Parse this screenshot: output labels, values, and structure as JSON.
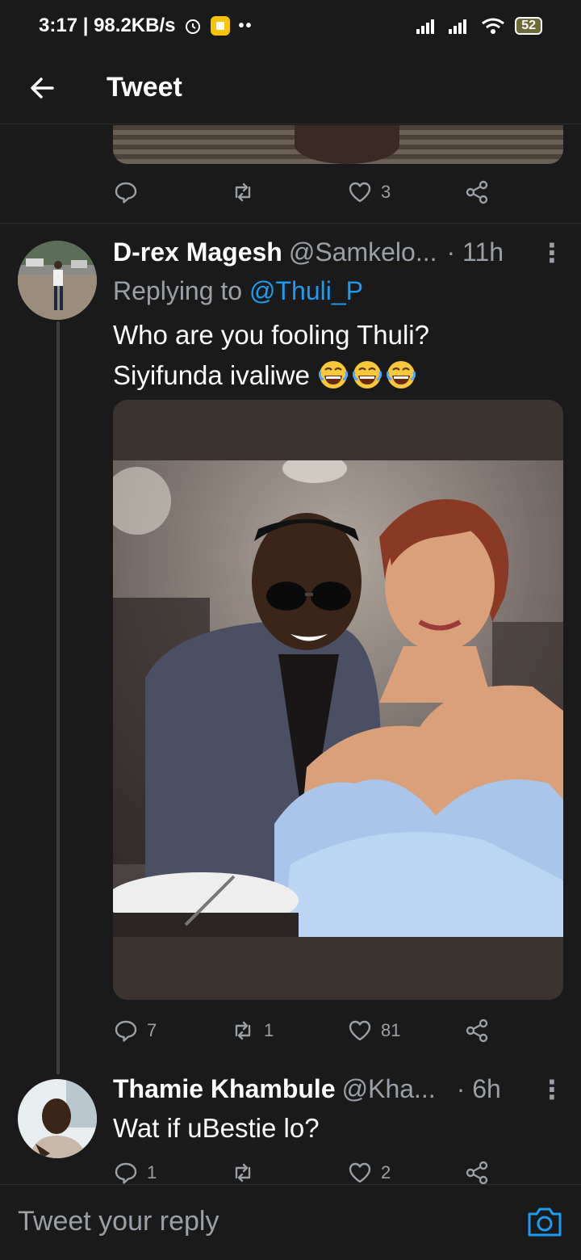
{
  "status_bar": {
    "time_speed": "3:17 | 98.2KB/s",
    "battery": "52"
  },
  "header": {
    "title": "Tweet"
  },
  "prev_tweet": {
    "likes": "3"
  },
  "tweets": [
    {
      "name": "D-rex Magesh",
      "handle": "@Samkelo...",
      "time": "· 11h",
      "replying_label": "Replying to ",
      "replying_to": "@Thuli_P",
      "text_line1": "Who are you fooling Thuli?",
      "text_line2": "Siyifunda ivaliwe ",
      "replies": "7",
      "retweets": "1",
      "likes": "81"
    },
    {
      "name": "Thamie Khambule",
      "handle": "@Kha...",
      "time": "· 6h",
      "text": "Wat if uBestie lo?",
      "replies": "1",
      "likes": "2"
    }
  ],
  "reply_bar": {
    "placeholder": "Tweet your reply"
  },
  "icons": [
    "back-arrow-icon",
    "reply-icon",
    "retweet-icon",
    "like-icon",
    "share-icon",
    "more-icon",
    "camera-icon",
    "alarm-icon",
    "signal-icon",
    "wifi-icon",
    "laughing-emoji-icon"
  ],
  "colors": {
    "background": "#1a1a1a",
    "accent": "#1d9bf0",
    "muted": "#9aa0a6"
  }
}
